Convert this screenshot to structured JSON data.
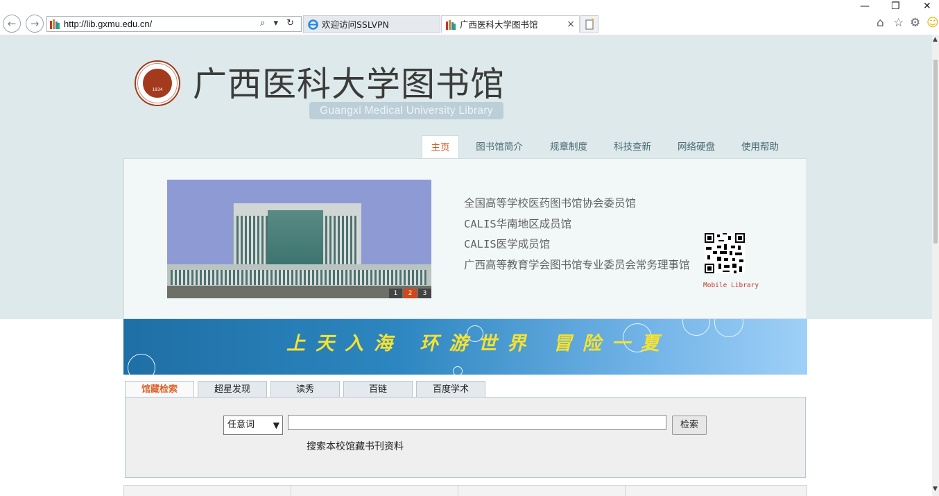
{
  "browser": {
    "url": "http://lib.gxmu.edu.cn/",
    "address_tools": "⌕ ▾ ↻",
    "tabs": [
      {
        "label": "欢迎访问SSLVPN"
      },
      {
        "label": "广西医科大学图书馆",
        "close": "×"
      }
    ],
    "window_controls": {
      "minimize": "—",
      "restore": "❐",
      "close": "✕"
    },
    "right_icons": [
      "home-icon",
      "star-icon",
      "gear-icon",
      "smiley-icon"
    ]
  },
  "header": {
    "seal_year": "1934",
    "title": "广西医科大学图书馆",
    "subtitle": "Guangxi Medical University Library"
  },
  "nav": {
    "items": [
      "主页",
      "图书馆简介",
      "规章制度",
      "科技查新",
      "网络硬盘",
      "使用帮助"
    ],
    "active_index": 0
  },
  "slider": {
    "dots": [
      "1",
      "2",
      "3"
    ],
    "active_dot": 1
  },
  "info": {
    "lines": [
      "全国高等学校医药图书馆协会委员馆",
      "CALIS华南地区成员馆",
      "CALIS医学成员馆",
      "广西高等教育学会图书馆专业委员会常务理事馆"
    ],
    "mobile_label": "Mobile Library"
  },
  "banner": {
    "text": "上天入海 环游世界 冒险一夏"
  },
  "search": {
    "tabs": [
      "馆藏检索",
      "超星发现",
      "读秀",
      "百链",
      "百度学术"
    ],
    "active_tab": 0,
    "field_select": "任意词",
    "query_value": "",
    "button_label": "检索",
    "hint": "搜索本校馆藏书刊资料"
  },
  "colors": {
    "page_band": "#dde9ea",
    "nav_active": "#d4581f",
    "banner_text": "#f6e22f",
    "search_tab_active": "#e0622a"
  }
}
